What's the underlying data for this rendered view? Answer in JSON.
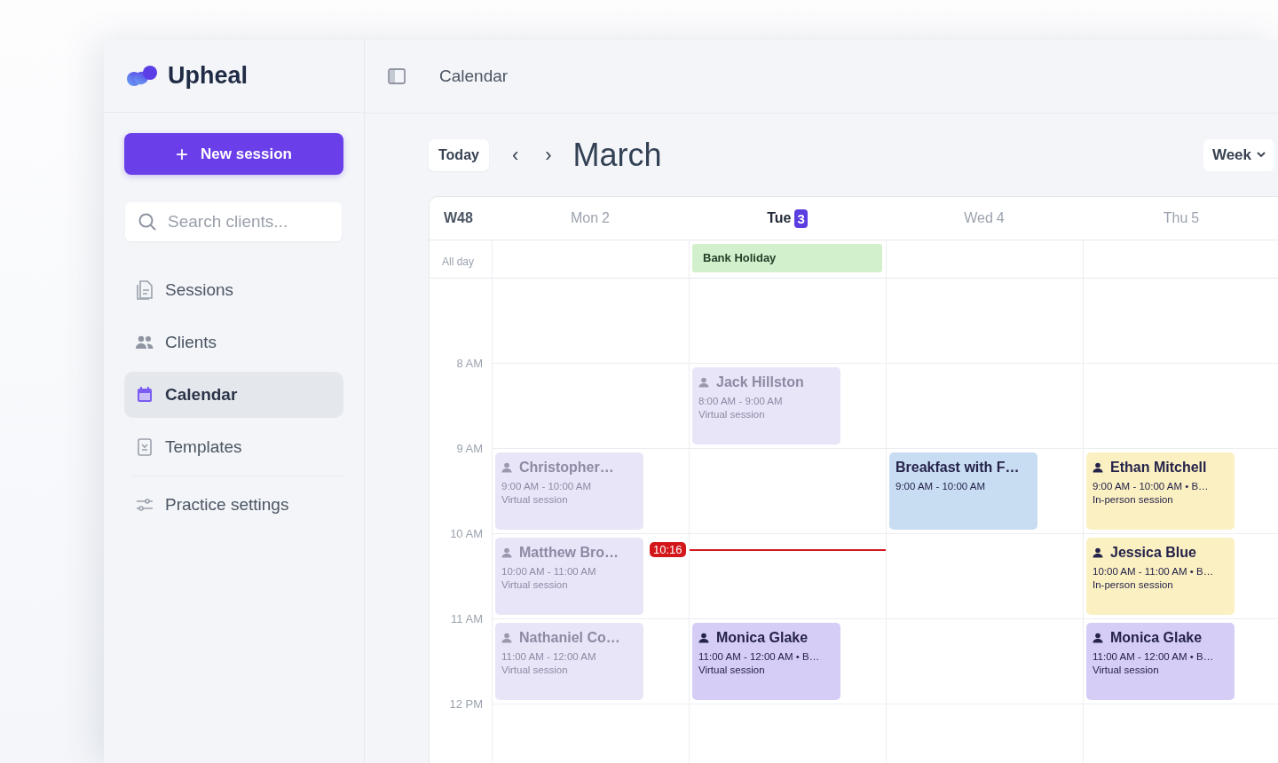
{
  "brand": {
    "name": "Upheal"
  },
  "new_session": {
    "label": "New session",
    "icon": "+"
  },
  "search": {
    "placeholder": "Search clients..."
  },
  "nav": [
    {
      "label": "Sessions",
      "kind": "document",
      "selected": false
    },
    {
      "label": "Clients",
      "kind": "people",
      "selected": false
    },
    {
      "label": "Calendar",
      "kind": "calendar",
      "selected": true
    },
    {
      "label": "Templates",
      "kind": "template",
      "selected": false
    }
  ],
  "bottom_nav": [
    {
      "label": "Practice settings",
      "kind": "sliders",
      "selected": false
    }
  ],
  "topbar": {
    "title": "Calendar"
  },
  "toolbar": {
    "today": "Today",
    "prev": "‹",
    "next": "›",
    "month": "March",
    "view": "Week"
  },
  "calendar": {
    "week": "W48",
    "all_day_label": "All day",
    "hours": [
      "8 AM",
      "9 AM",
      "10 AM",
      "11 AM",
      "12 PM"
    ],
    "days": [
      {
        "weekday": "Mon",
        "date": "2",
        "today": false,
        "slots": [
          {
            "kind": "empty"
          },
          {
            "kind": "empty"
          },
          {
            "kind": "session",
            "name": "Christopher…",
            "time": "9:00 AM - 10:00 AM",
            "mode": "Virtual session",
            "past": true,
            "color": "#e9e5f9"
          },
          {
            "kind": "session",
            "name": "Matthew Bro…",
            "time": "10:00 AM - 11:00 AM",
            "mode": "Virtual session",
            "past": true,
            "color": "#e9e5f9"
          },
          {
            "kind": "session",
            "name": "Nathaniel Co…",
            "time": "11:00 AM - 12:00 AM",
            "mode": "Virtual session",
            "past": true,
            "color": "#e9e5f9"
          }
        ]
      },
      {
        "weekday": "Tue",
        "date": "3",
        "today": true,
        "all_day": [
          {
            "label": "Bank Holiday",
            "color": "#d3f0cd"
          }
        ],
        "slots": [
          {
            "kind": "empty"
          },
          {
            "kind": "session",
            "name": "Jack Hillston",
            "time": "8:00 AM - 9:00 AM",
            "mode": "Virtual session",
            "past": true,
            "color": "#e9e5f9"
          },
          {
            "kind": "empty"
          },
          {
            "kind": "empty",
            "now": "10:16"
          },
          {
            "kind": "session",
            "name": "Monica Glake",
            "time": "11:00 AM - 12:00 AM • B…",
            "mode": "Virtual session",
            "past": false,
            "color": "#d6cdf6"
          }
        ]
      },
      {
        "weekday": "Wed",
        "date": "4",
        "today": false,
        "slots": [
          {
            "kind": "empty"
          },
          {
            "kind": "empty"
          },
          {
            "kind": "event",
            "name": "Breakfast with F…",
            "time": "9:00 AM - 10:00 AM",
            "past": false,
            "color": "#c8ddf2"
          },
          {
            "kind": "empty"
          },
          {
            "kind": "empty"
          }
        ]
      },
      {
        "weekday": "Thu",
        "date": "5",
        "today": false,
        "slots": [
          {
            "kind": "empty"
          },
          {
            "kind": "empty"
          },
          {
            "kind": "session",
            "name": "Ethan Mitchell",
            "time": "9:00 AM - 10:00 AM • B…",
            "mode": "In-person session",
            "past": false,
            "color": "#fbf0c2"
          },
          {
            "kind": "session",
            "name": "Jessica Blue",
            "time": "10:00 AM - 11:00 AM • B…",
            "mode": "In-person session",
            "past": false,
            "color": "#fbf0c2"
          },
          {
            "kind": "session",
            "name": "Monica Glake",
            "time": "11:00 AM - 12:00 AM • B…",
            "mode": "Virtual session",
            "past": false,
            "color": "#d6cdf6"
          }
        ]
      }
    ]
  }
}
